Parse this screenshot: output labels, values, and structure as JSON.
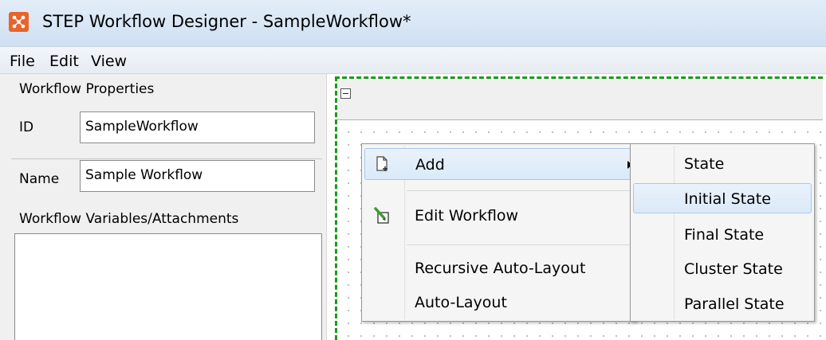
{
  "window": {
    "title": "STEP Workflow Designer - SampleWorkflow*",
    "app_icon": "step-app-icon",
    "accent": "#e8642c"
  },
  "menubar": {
    "items": [
      {
        "label": "File"
      },
      {
        "label": "Edit"
      },
      {
        "label": "View"
      }
    ]
  },
  "properties": {
    "title": "Workflow Properties",
    "id_label": "ID",
    "id_value": "SampleWorkflow",
    "name_label": "Name",
    "name_value": "Sample Workflow"
  },
  "variables": {
    "title": "Workflow Variables/Attachments"
  },
  "canvas": {
    "collapse_icon": "collapse-minus-icon",
    "selection_color": "#1a9a1a"
  },
  "context_menu": {
    "items": [
      {
        "label": "Add",
        "icon": "add-document-icon",
        "has_submenu": true,
        "highlighted": true
      },
      {
        "label": "Edit Workflow",
        "icon": "edit-pencil-icon"
      },
      {
        "label": "Recursive Auto-Layout"
      },
      {
        "label": "Auto-Layout"
      }
    ]
  },
  "submenu": {
    "items": [
      {
        "label": "State"
      },
      {
        "label": "Initial State",
        "highlighted": true
      },
      {
        "label": "Final State"
      },
      {
        "label": "Cluster State"
      },
      {
        "label": "Parallel State"
      }
    ]
  }
}
